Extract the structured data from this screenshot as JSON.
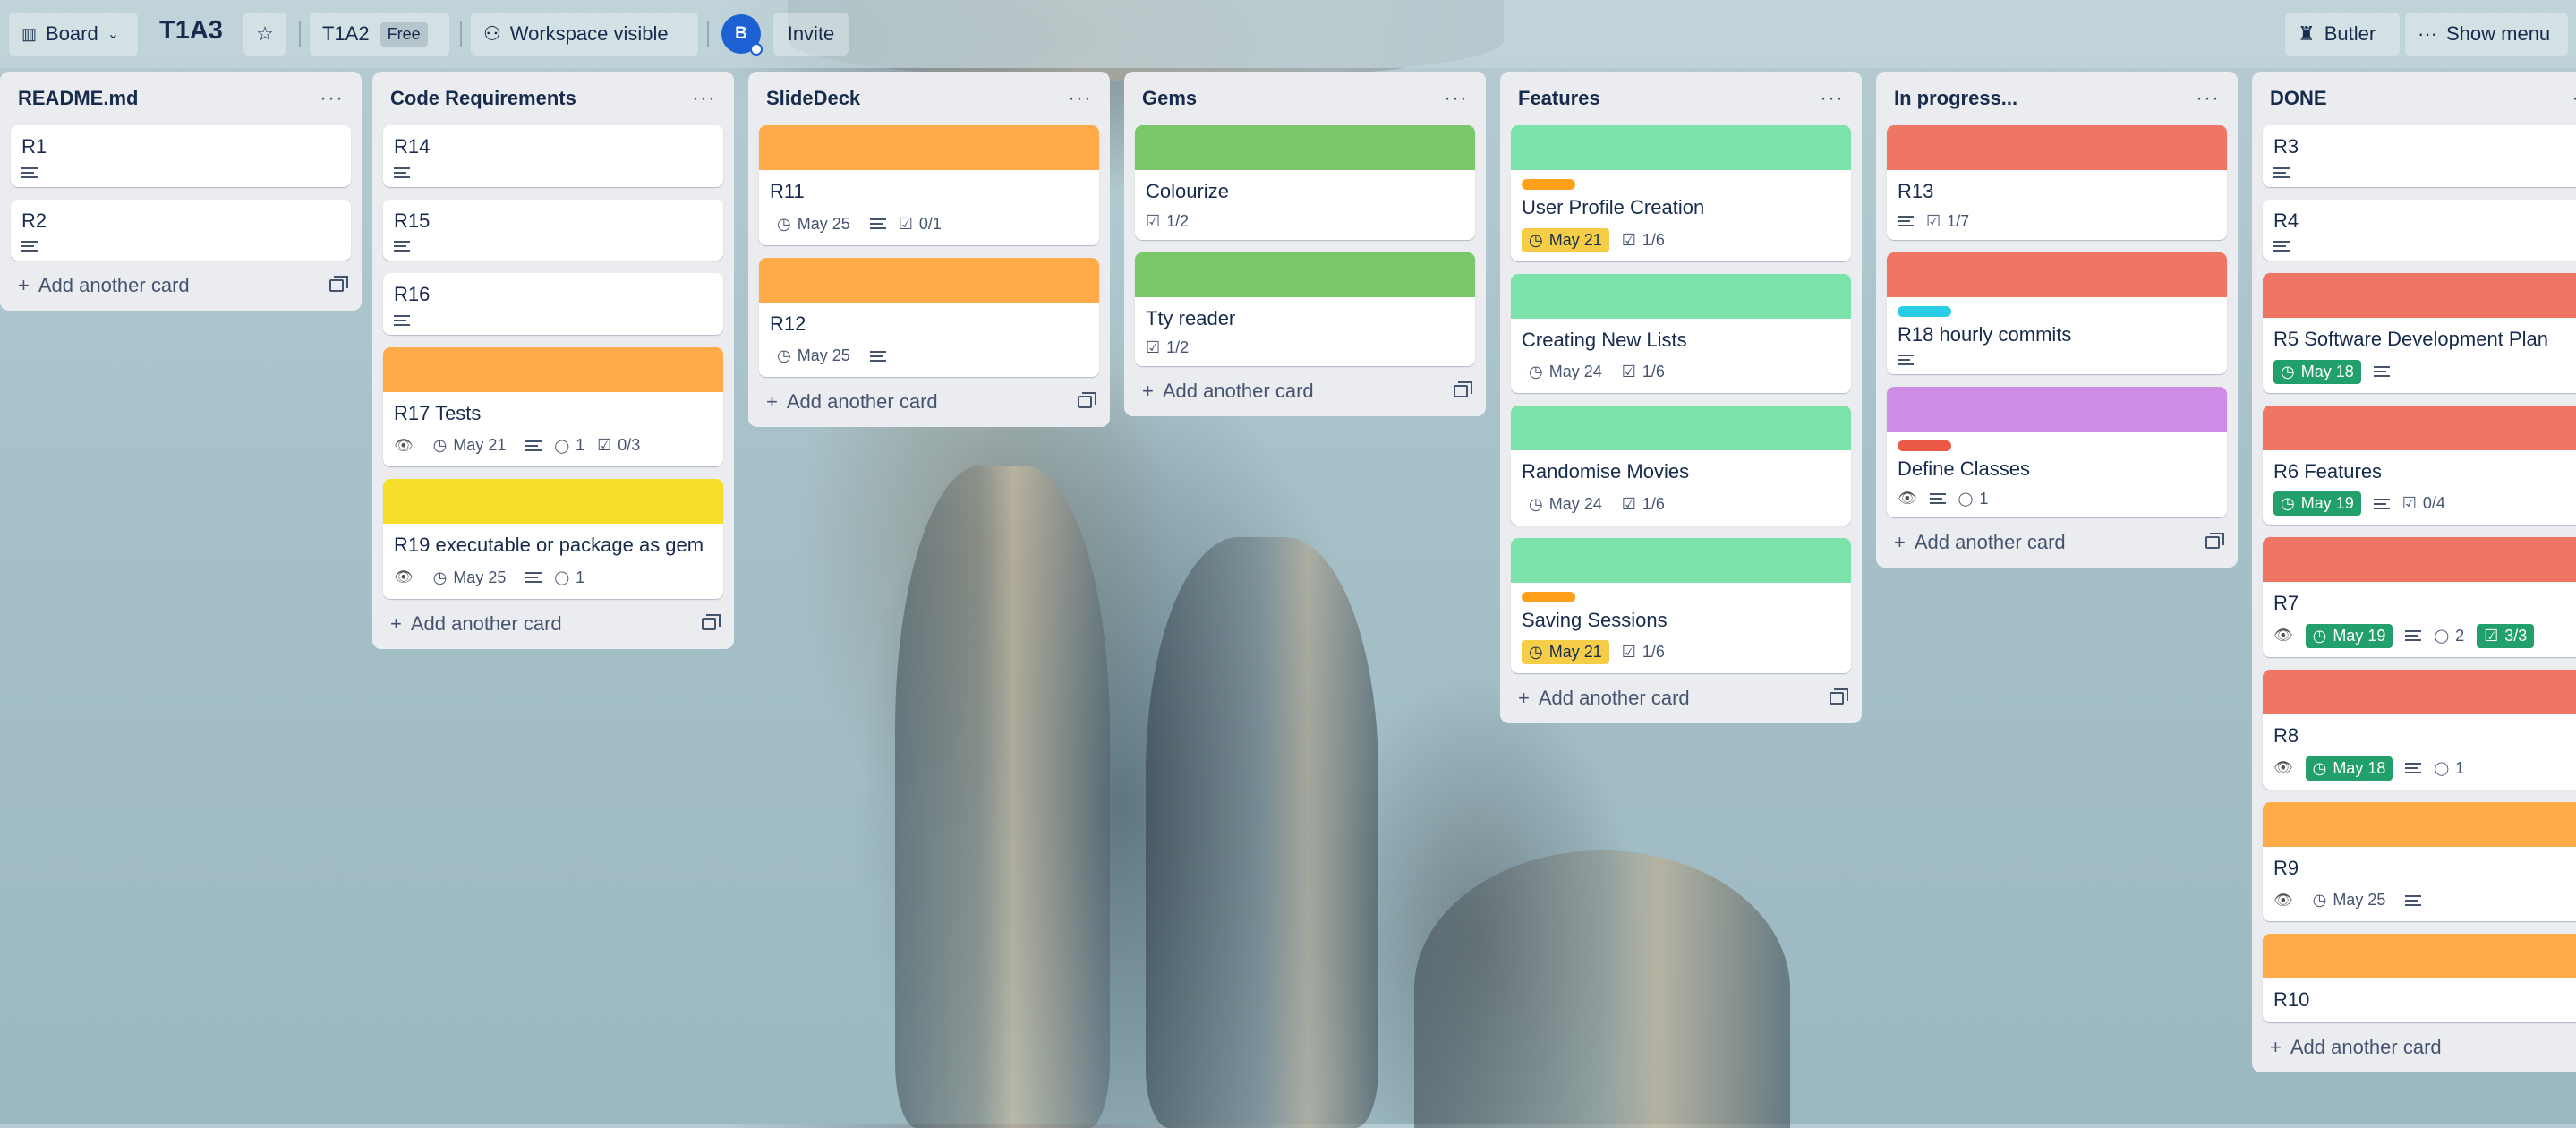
{
  "header": {
    "view_label": "Board",
    "board_title": "T1A3",
    "workspace_name": "T1A2",
    "workspace_plan": "Free",
    "visibility_label": "Workspace visible",
    "avatar_initial": "B",
    "invite_label": "Invite",
    "butler_label": "Butler",
    "show_menu_label": "Show menu"
  },
  "add_card_label": "Add another card",
  "colors": {
    "orange": "#ffab4a",
    "green": "#7bc86c",
    "red": "#ef7564",
    "yellow": "#f5dd29",
    "mint": "#7be3a9",
    "purple": "#cd8de5",
    "sky": "#29cce5",
    "label_orange": "#ff9f1a",
    "label_red": "#eb5a46"
  },
  "lists": [
    {
      "title": "README.md",
      "cards": [
        {
          "title": "R1",
          "desc": true
        },
        {
          "title": "R2",
          "desc": true
        }
      ]
    },
    {
      "title": "Code Requirements",
      "cards": [
        {
          "title": "R14",
          "desc": true
        },
        {
          "title": "R15",
          "desc": true
        },
        {
          "title": "R16",
          "desc": true
        },
        {
          "title": "R17 Tests",
          "cover": "orange",
          "watch": true,
          "due": "May 21",
          "desc": true,
          "comments": "1",
          "checklist": "0/3"
        },
        {
          "title": "R19 executable or package as gem",
          "cover": "yellow",
          "watch": true,
          "due": "May 25",
          "desc": true,
          "comments": "1"
        }
      ]
    },
    {
      "title": "SlideDeck",
      "cards": [
        {
          "title": "R11",
          "cover": "orange",
          "due": "May 25",
          "desc": true,
          "checklist": "0/1"
        },
        {
          "title": "R12",
          "cover": "orange",
          "due": "May 25",
          "desc": true
        }
      ]
    },
    {
      "title": "Gems",
      "cards": [
        {
          "title": "Colourize",
          "cover": "green",
          "checklist": "1/2"
        },
        {
          "title": "Tty reader",
          "cover": "green",
          "checklist": "1/2"
        }
      ]
    },
    {
      "title": "Features",
      "cards": [
        {
          "title": "User Profile Creation",
          "cover": "mint",
          "label": "label_orange",
          "due": "May 21",
          "due_state": "soon",
          "checklist": "1/6"
        },
        {
          "title": "Creating New Lists",
          "cover": "mint",
          "due": "May 24",
          "checklist": "1/6"
        },
        {
          "title": "Randomise Movies",
          "cover": "mint",
          "due": "May 24",
          "checklist": "1/6"
        },
        {
          "title": "Saving Sessions",
          "cover": "mint",
          "label": "label_orange",
          "due": "May 21",
          "due_state": "soon",
          "checklist": "1/6"
        }
      ]
    },
    {
      "title": "In progress...",
      "cards": [
        {
          "title": "R13",
          "cover": "red",
          "desc": true,
          "checklist": "1/7"
        },
        {
          "title": "R18 hourly commits",
          "cover": "red",
          "label": "sky",
          "desc": true
        },
        {
          "title": "Define Classes",
          "cover": "purple",
          "label": "label_red",
          "watch": true,
          "desc": true,
          "comments": "1"
        }
      ]
    },
    {
      "title": "DONE",
      "cards": [
        {
          "title": "R3",
          "desc": true
        },
        {
          "title": "R4",
          "desc": true
        },
        {
          "title": "R5 Software Development Plan",
          "cover": "red",
          "due": "May 18",
          "due_state": "done",
          "desc": true
        },
        {
          "title": "R6 Features",
          "cover": "red",
          "due": "May 19",
          "due_state": "done",
          "desc": true,
          "checklist": "0/4"
        },
        {
          "title": "R7",
          "cover": "red",
          "watch": true,
          "due": "May 19",
          "due_state": "done",
          "desc": true,
          "comments": "2",
          "checklist": "3/3",
          "checklist_state": "done"
        },
        {
          "title": "R8",
          "cover": "red",
          "watch": true,
          "due": "May 18",
          "due_state": "done",
          "desc": true,
          "comments": "1"
        },
        {
          "title": "R9",
          "cover": "orange",
          "watch": true,
          "due": "May 25",
          "desc": true
        },
        {
          "title": "R10",
          "cover": "orange"
        }
      ]
    }
  ]
}
